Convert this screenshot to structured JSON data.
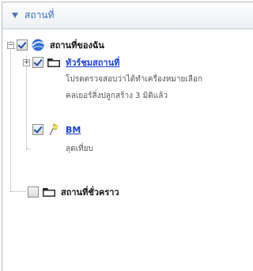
{
  "header": {
    "title": "สถานที่"
  },
  "tree": {
    "my_places": {
      "label": "สถานที่ของฉัน",
      "expander": "−",
      "checked": true
    },
    "sightseeing": {
      "label": "ทัวร์ชมสถานที่",
      "expander": "+",
      "checked": true,
      "description_line1": "โปรดตรวจสอบว่าได้ทำเครื่องหมายเลือก",
      "description_line2": "คลเยอร์สิ่งปลูกสร้าง 3 มิติแล้ว"
    },
    "bm": {
      "label": "BM",
      "description": "ลุดเที่ยบ",
      "checked": true
    },
    "temporary": {
      "label": "สถานที่ชั่วคราว",
      "checked": false
    }
  },
  "colors": {
    "link": "#1a3fd0",
    "accent": "#3b6fb6",
    "pushpin": "#f5d21a"
  }
}
